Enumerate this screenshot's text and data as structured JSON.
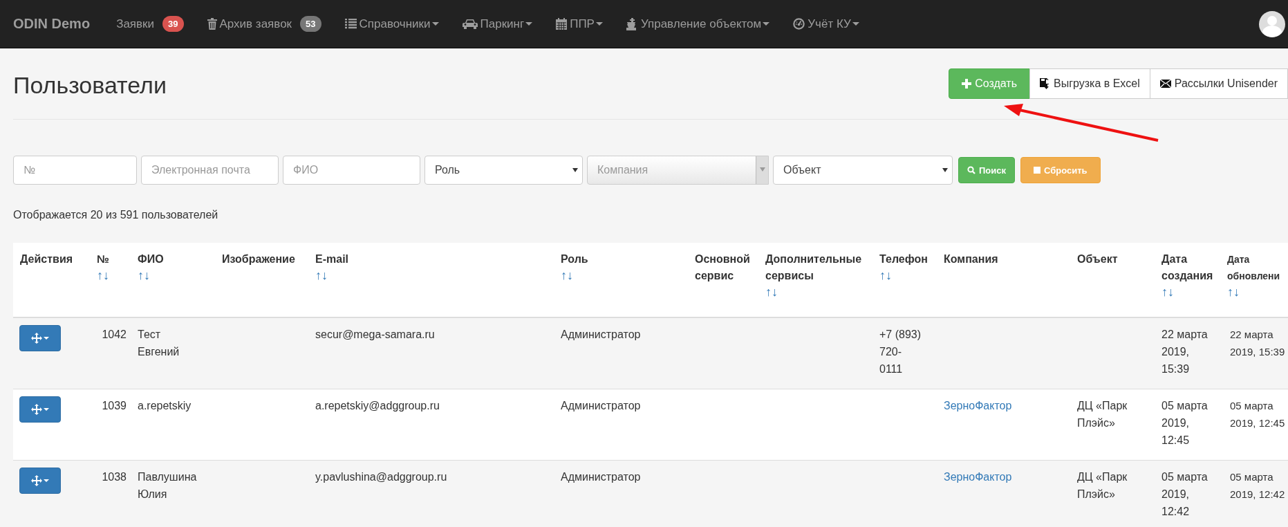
{
  "navbar": {
    "brand": "ODIN Demo",
    "items": [
      {
        "label": "Заявки",
        "badge": {
          "text": "39",
          "color": "#d9534f"
        },
        "dropdown": false
      },
      {
        "label": "Архив заявок",
        "badge": {
          "text": "53",
          "color": "#777777"
        },
        "dropdown": false
      },
      {
        "label": "Справочники",
        "dropdown": true
      },
      {
        "label": "Паркинг",
        "dropdown": true
      },
      {
        "label": "ППР",
        "dropdown": true
      },
      {
        "label": "Управление объектом",
        "dropdown": true
      },
      {
        "label": "Учёт КУ",
        "dropdown": true
      }
    ]
  },
  "page": {
    "title": "Пользователи",
    "buttons": [
      {
        "kind": "create",
        "label": "Создать"
      },
      {
        "kind": "excel",
        "label": "Выгрузка в Excel"
      },
      {
        "kind": "mail",
        "label": "Рассылки Unisender"
      }
    ]
  },
  "filters": [
    {
      "kind": "input",
      "placeholder": "№"
    },
    {
      "kind": "input",
      "placeholder": "Электронная почта"
    },
    {
      "kind": "input",
      "placeholder": "ФИО"
    },
    {
      "kind": "select",
      "value": "Роль",
      "disabled": false
    },
    {
      "kind": "select",
      "placeholder": "Компания",
      "disabled": true
    },
    {
      "kind": "select",
      "value": "Объект",
      "disabled": false
    },
    {
      "kind": "search",
      "label": "Поиск"
    },
    {
      "kind": "reset",
      "label": "Сбросить"
    }
  ],
  "summary": "Отображается 20 из 591 пользователей",
  "table": {
    "columns": [
      {
        "label": [
          "Действия"
        ]
      },
      {
        "label": [
          "№"
        ],
        "sort": "↑↓"
      },
      {
        "label": [
          "ФИО"
        ],
        "sort": "↑↓"
      },
      {
        "label": [
          "Изображение"
        ]
      },
      {
        "label": [
          "E-mail"
        ],
        "sort": "↑↓"
      },
      {
        "label": [
          "Роль"
        ],
        "sort": "↑↓"
      },
      {
        "label": [
          "Основной",
          "сервис"
        ]
      },
      {
        "label": [
          "Дополнительные",
          "сервисы"
        ],
        "sort": "↑↓"
      },
      {
        "label": [
          "Телефон"
        ],
        "sort": "↑↓"
      },
      {
        "label": [
          "Компания"
        ]
      },
      {
        "label": [
          "Объект"
        ]
      },
      {
        "label": [
          "Дата",
          "создания"
        ],
        "sort": "↑↓"
      },
      {
        "label": [
          "Дата",
          "обновлени"
        ],
        "sort": "↑↓"
      }
    ],
    "rows": [
      {
        "id": "1042",
        "name": [
          "Тест",
          "Евгений"
        ],
        "email": "secur@mega-samara.ru",
        "role": "Администратор",
        "phone": [
          "+7 (893)",
          "720-",
          "0111"
        ],
        "company": "",
        "object": [],
        "created": [
          "22 марта",
          "2019,",
          "15:39"
        ],
        "updated": [
          "22 марта",
          "2019, 15:39"
        ]
      },
      {
        "id": "1039",
        "name": [
          "a.repetskiy"
        ],
        "email": "a.repetskiy@adggroup.ru",
        "role": "Администратор",
        "phone": [],
        "company": "ЗерноФактор",
        "object": [
          "ДЦ «Парк",
          "Плэйс»"
        ],
        "created": [
          "05 марта",
          "2019,",
          "12:45"
        ],
        "updated": [
          "05 марта",
          "2019, 12:45"
        ]
      },
      {
        "id": "1038",
        "name": [
          "Павлушина",
          "Юлия"
        ],
        "email": "y.pavlushina@adggroup.ru",
        "role": "Администратор",
        "phone": [],
        "company": "ЗерноФактор",
        "object": [
          "ДЦ «Парк",
          "Плэйс»"
        ],
        "created": [
          "05 марта",
          "2019,",
          "12:42"
        ],
        "updated": [
          "05 марта",
          "2019, 12:42"
        ]
      }
    ]
  }
}
